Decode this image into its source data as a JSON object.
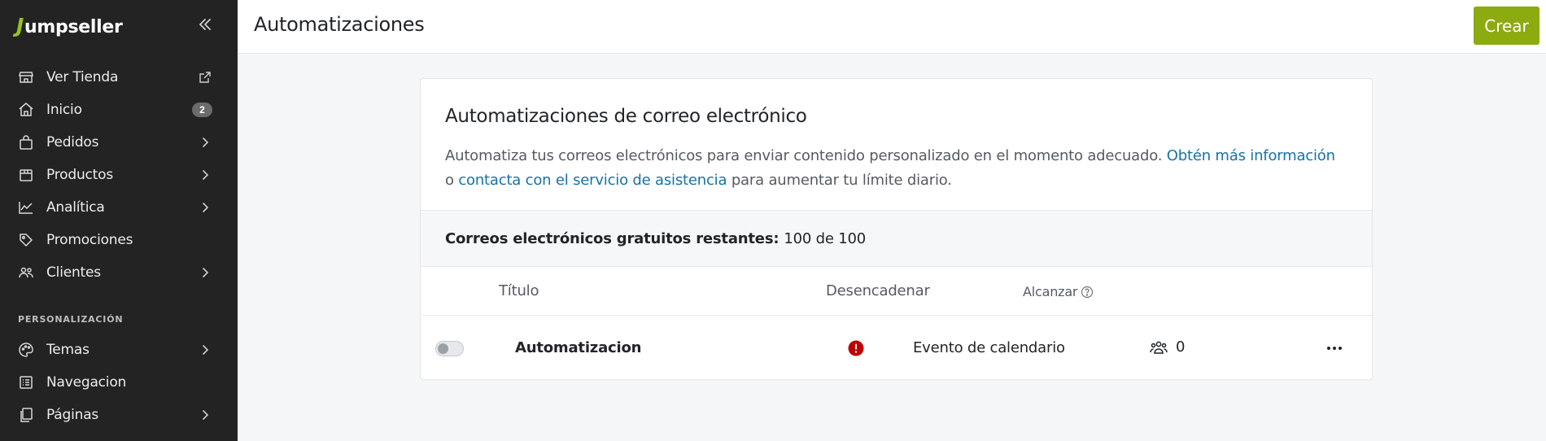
{
  "brand": {
    "name": "umpseller",
    "initial": "J"
  },
  "sidebar": {
    "items": [
      {
        "label": "Ver Tienda",
        "icon": "store-icon",
        "trailing": "external-link-icon"
      },
      {
        "label": "Inicio",
        "icon": "home-icon",
        "badge": "2"
      },
      {
        "label": "Pedidos",
        "icon": "shopping-bag-icon",
        "trailing": "chevron-right-icon"
      },
      {
        "label": "Productos",
        "icon": "box-icon",
        "trailing": "chevron-right-icon"
      },
      {
        "label": "Analítica",
        "icon": "chart-icon",
        "trailing": "chevron-right-icon"
      },
      {
        "label": "Promociones",
        "icon": "tag-icon"
      },
      {
        "label": "Clientes",
        "icon": "users-icon",
        "trailing": "chevron-right-icon"
      }
    ],
    "section_label": "PERSONALIZACIÓN",
    "items2": [
      {
        "label": "Temas",
        "icon": "palette-icon",
        "trailing": "chevron-right-icon"
      },
      {
        "label": "Navegacion",
        "icon": "list-icon"
      },
      {
        "label": "Páginas",
        "icon": "pages-icon",
        "trailing": "chevron-right-icon"
      }
    ]
  },
  "header": {
    "title": "Automatizaciones",
    "create_label": "Crear"
  },
  "card": {
    "title": "Automatizaciones de correo electrónico",
    "desc_start": "Automatiza tus correos electrónicos para enviar contenido personalizado en el momento adecuado. ",
    "link_more": "Obtén más información",
    "desc_or": " o ",
    "link_support": "contacta con el servicio de asistencia",
    "desc_end": " para aumentar tu límite diario.",
    "quota_label": "Correos electrónicos gratuitos restantes:",
    "quota_value": "100 de 100"
  },
  "table": {
    "col_title": "Título",
    "col_trigger": "Desencadenar",
    "col_reach": "Alcanzar",
    "rows": [
      {
        "title": "Automatizacion",
        "trigger": "Evento de calendario",
        "reach": "0",
        "enabled": false
      }
    ]
  },
  "colors": {
    "accent": "#8cab10",
    "link": "#1672a6",
    "alert": "#c00000",
    "sidebar": "#232323"
  }
}
